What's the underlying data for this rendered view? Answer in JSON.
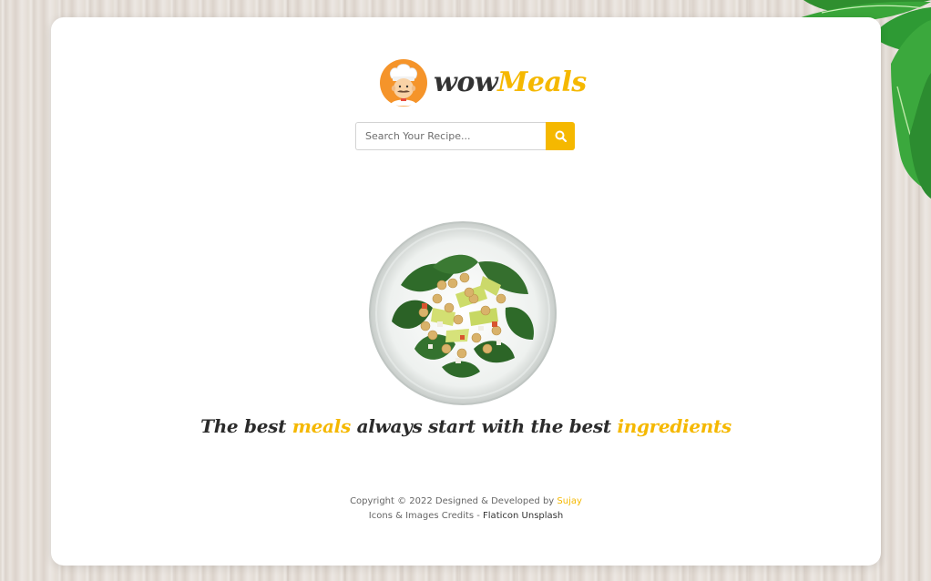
{
  "brand": {
    "name_prefix": "wow",
    "name_accent": "Meals",
    "logo_icon": "chef-icon",
    "accent_color": "#f5b800"
  },
  "search": {
    "placeholder": "Search Your Recipe...",
    "value": "",
    "button_icon": "search-icon"
  },
  "hero": {
    "image": "salad-bowl",
    "tagline_parts": [
      "The best ",
      "meals",
      " always start with the best ",
      "ingredients"
    ]
  },
  "footer": {
    "copyright": "Copyright © 2022 Designed & Developed by ",
    "author": "Sujay",
    "credits_label": "Icons & Images Credits - ",
    "credit_links": [
      "Flaticon",
      "Unsplash"
    ]
  },
  "colors": {
    "accent": "#f5b800",
    "card": "#ffffff",
    "text_dark": "#2b2b2b"
  }
}
